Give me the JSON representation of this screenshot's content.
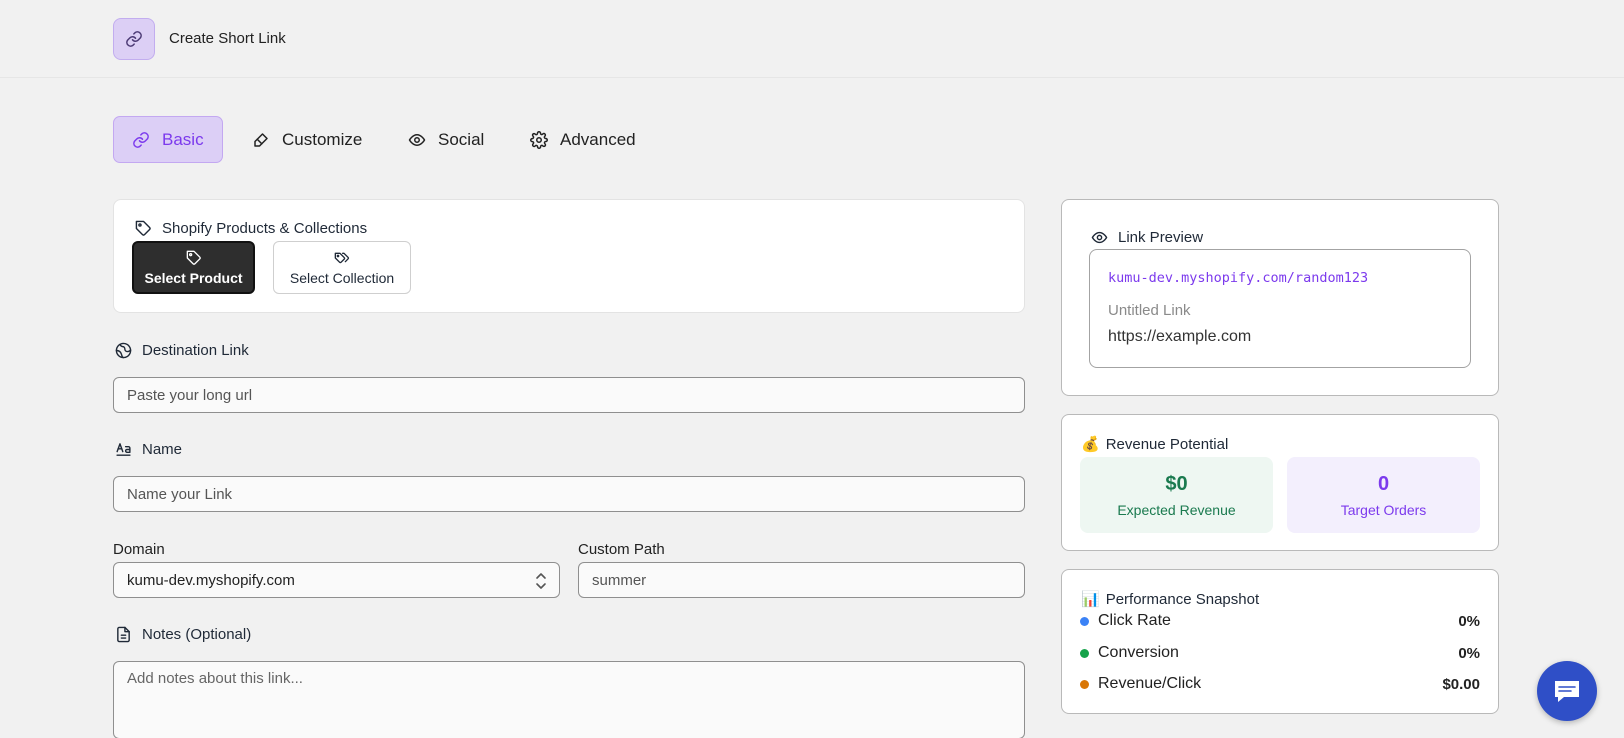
{
  "header": {
    "title": "Create Short Link",
    "logo_icon": "link-icon"
  },
  "tabs": [
    {
      "label": "Basic",
      "icon": "link-icon",
      "active": true
    },
    {
      "label": "Customize",
      "icon": "brush-icon",
      "active": false
    },
    {
      "label": "Social",
      "icon": "eye-icon",
      "active": false
    },
    {
      "label": "Advanced",
      "icon": "gear-icon",
      "active": false
    }
  ],
  "shopify": {
    "title": "Shopify Products & Collections",
    "select_product": "Select Product",
    "select_collection": "Select Collection"
  },
  "form": {
    "destination_label": "Destination Link",
    "destination_placeholder": "Paste your long url",
    "name_label": "Name",
    "name_placeholder": "Name your Link",
    "domain_label": "Domain",
    "domain_value": "kumu-dev.myshopify.com",
    "custom_path_label": "Custom Path",
    "custom_path_placeholder": "summer",
    "notes_label": "Notes (Optional)",
    "notes_placeholder": "Add notes about this link..."
  },
  "preview": {
    "title": "Link Preview",
    "short_url": "kumu-dev.myshopify.com/random123",
    "link_name": "Untitled Link",
    "destination": "https://example.com"
  },
  "revenue": {
    "title": "Revenue Potential",
    "emoji": "💰",
    "expected_value": "$0",
    "expected_label": "Expected Revenue",
    "orders_value": "0",
    "orders_label": "Target Orders"
  },
  "performance": {
    "title": "Performance Snapshot",
    "emoji": "📊",
    "rows": [
      {
        "label": "Click Rate",
        "value": "0%",
        "color": "#3b82f6"
      },
      {
        "label": "Conversion",
        "value": "0%",
        "color": "#16a34a"
      },
      {
        "label": "Revenue/Click",
        "value": "$0.00",
        "color": "#d97706"
      }
    ]
  },
  "colors": {
    "accent": "#7c3aed",
    "accent_bg": "#dccff6",
    "chat_button": "#2f4fc7"
  }
}
